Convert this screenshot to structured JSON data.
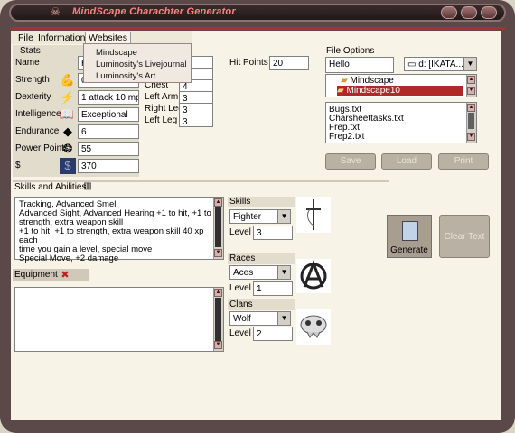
{
  "window": {
    "title": "MindScape Charachter Generator"
  },
  "menu": {
    "file": "File",
    "information": "Information",
    "websites": "Websites"
  },
  "websites_menu": {
    "items": [
      "Mindscape",
      "Luminosity's Livejournal",
      "Luminosity's Art"
    ]
  },
  "stats": {
    "header": "Stats",
    "name_label": "Name",
    "name_value": "H",
    "rows": [
      {
        "label": "Strength",
        "value": "0",
        "icon": "flex-arm-icon"
      },
      {
        "label": "Dexterity",
        "value": "1 attack 10 mph",
        "icon": "lightning-icon"
      },
      {
        "label": "Intelligence",
        "value": "Exceptional",
        "icon": "book-icon"
      },
      {
        "label": "Endurance",
        "value": "6",
        "icon": "shield-icon"
      },
      {
        "label": "Power Points",
        "value": "55",
        "icon": "brain-icon"
      },
      {
        "label": "$",
        "value": "370",
        "icon": "money-icon"
      }
    ]
  },
  "body_parts": {
    "chest_label": "Chest",
    "chest_value": "4",
    "left_arm_label": "Left Arm",
    "left_arm_value": "3",
    "right_leg_label": "Right Leg",
    "right_leg_value": "3",
    "left_leg_label": "Left Leg",
    "left_leg_value": "3"
  },
  "hit_points": {
    "label": "Hit Points",
    "value": "20"
  },
  "file_options": {
    "header": "File Options",
    "filename": "Hello",
    "drive": "d: [IKATA...]",
    "folders": [
      "Mindscape",
      "Mindscape10"
    ],
    "files": [
      "Bugs.txt",
      "Charsheettasks.txt",
      "Frep.txt",
      "Frep2.txt"
    ],
    "save": "Save",
    "load": "Load",
    "print": "Print"
  },
  "skills_abilities": {
    "header": "Skills and Abilities",
    "text": [
      "Tracking, Advanced Smell",
      "Advanced Sight, Advanced Hearing +1 to hit, +1 to",
      "strength, extra weapon skill",
      "+1 to hit, +1 to strength, extra weapon skill 40 xp each",
      "time you gain a level, special move",
      "Special Move, +2 damage"
    ]
  },
  "equipment": {
    "header": "Equipment"
  },
  "skills": {
    "header": "Skills",
    "selected": "Fighter",
    "level_label": "Level",
    "level": "3"
  },
  "races": {
    "header": "Races",
    "selected": "Aces",
    "level_label": "Level",
    "level": "1"
  },
  "clans": {
    "header": "Clans",
    "selected": "Wolf",
    "level_label": "Level",
    "level": "2"
  },
  "actions": {
    "generate": "Generate",
    "clear": "Clear Text"
  }
}
